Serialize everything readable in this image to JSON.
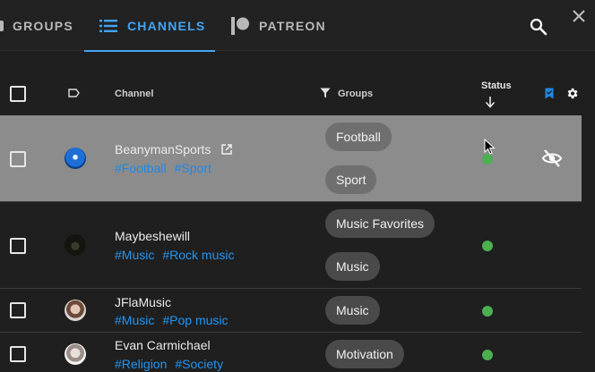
{
  "tabs": {
    "groups": "GROUPS",
    "channels": "CHANNELS",
    "patreon": "PATREON"
  },
  "toolbar": {
    "search_icon": "search-icon",
    "close_icon": "close-icon"
  },
  "table": {
    "headers": {
      "channel": "Channel",
      "groups": "Groups",
      "status": "Status"
    },
    "rows": [
      {
        "name": "BeanymanSports",
        "tags": [
          "#Football",
          "#Sport"
        ],
        "groups": [
          "Football",
          "Sport"
        ],
        "status": "online",
        "selected": true
      },
      {
        "name": "Maybeshewill",
        "tags": [
          "#Music",
          "#Rock music"
        ],
        "groups": [
          "Music Favorites",
          "Music"
        ],
        "status": "online"
      },
      {
        "name": "JFlaMusic",
        "tags": [
          "#Music",
          "#Pop music"
        ],
        "groups": [
          "Music"
        ],
        "status": "online"
      },
      {
        "name": "Evan Carmichael",
        "tags": [
          "#Religion",
          "#Society"
        ],
        "groups": [
          "Motivation"
        ],
        "status": "online"
      }
    ]
  },
  "colors": {
    "accent": "#42a5f5",
    "tag": "#2196f3",
    "status_online": "#4caf50",
    "selected_row": "#8c8c8c"
  }
}
